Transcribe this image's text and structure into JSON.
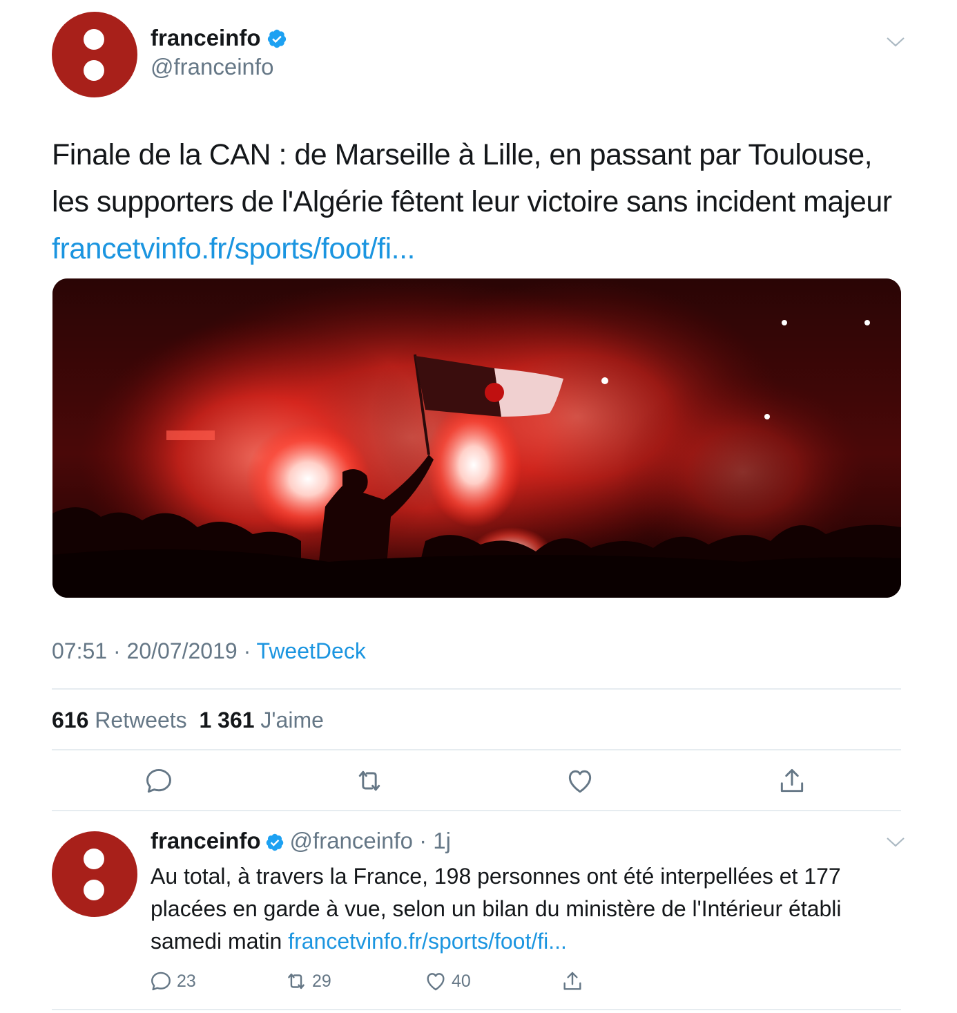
{
  "tweet": {
    "author_name": "franceinfo",
    "author_handle": "@franceinfo",
    "text": "Finale de la CAN : de Marseille à Lille, en passant par Toulouse, les supporters de l'Algérie fêtent leur victoire sans incident majeur ",
    "link": "francetvinfo.fr/sports/foot/fi...",
    "time": "07:51",
    "date": "20/07/2019",
    "source": "TweetDeck",
    "retweets_count": "616",
    "retweets_label": "Retweets",
    "likes_count": "1 361",
    "likes_label": "J'aime"
  },
  "reply": {
    "author_name": "franceinfo",
    "author_handle": "@franceinfo",
    "age": "1j",
    "text": "Au total, à travers la France, 198 personnes ont été interpellées et 177 placées en garde à vue, selon un bilan du ministère de l'Intérieur établi samedi matin ",
    "link": "francetvinfo.fr/sports/foot/fi...",
    "replies": "23",
    "retweets": "29",
    "likes": "40"
  },
  "colors": {
    "link": "#1b95e0",
    "secondary_text": "#657786",
    "avatar": "#a8201a",
    "verified": "#1da1f2"
  },
  "icons": [
    "verified-icon",
    "chevron-down-icon",
    "reply-icon",
    "retweet-icon",
    "like-icon",
    "share-icon"
  ]
}
